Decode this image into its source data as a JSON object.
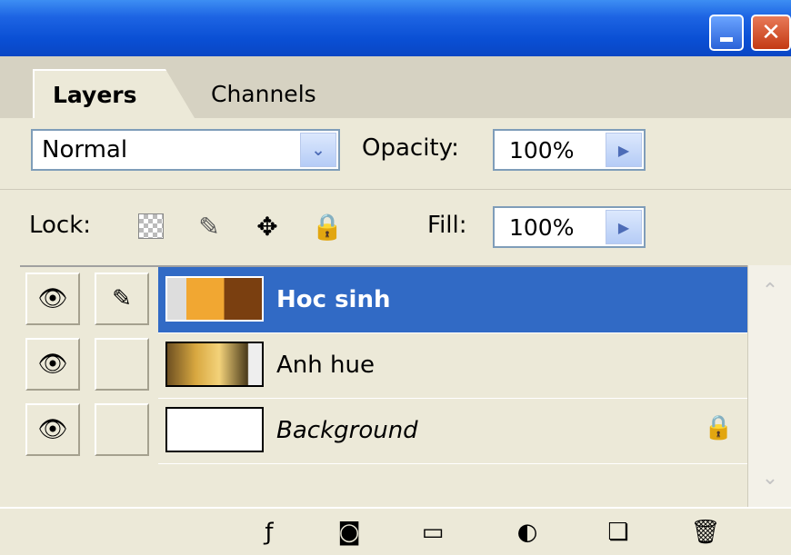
{
  "tabs": {
    "layers": "Layers",
    "channels": "Channels"
  },
  "blend": {
    "mode": "Normal",
    "opacity_label": "Opacity:",
    "opacity_value": "100%"
  },
  "lock": {
    "label": "Lock:",
    "fill_label": "Fill:",
    "fill_value": "100%"
  },
  "layers": [
    {
      "name": "Hoc sinh",
      "selected": true
    },
    {
      "name": "Anh hue",
      "selected": false
    },
    {
      "name": "Background",
      "selected": false,
      "locked": true
    }
  ],
  "colors": {
    "titlebar": "#0a4fd4",
    "selection": "#316ac5",
    "panel": "#ece9d8"
  }
}
